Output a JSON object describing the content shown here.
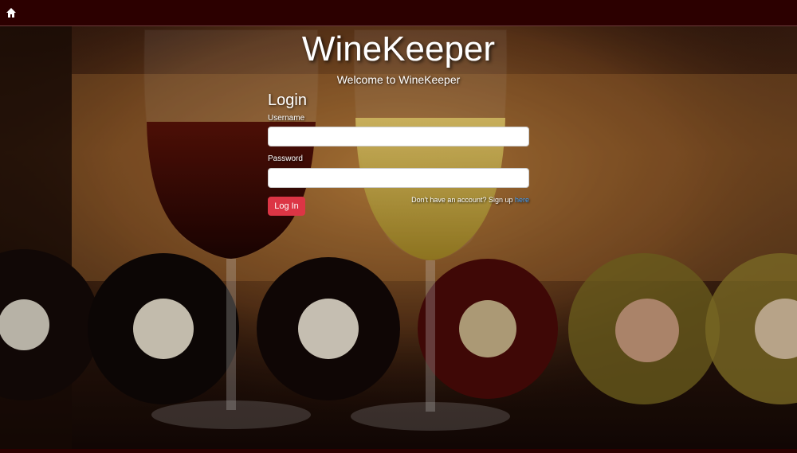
{
  "nav": {
    "home_icon": "home-icon"
  },
  "header": {
    "title": "WineKeeper",
    "subtitle": "Welcome to WineKeeper"
  },
  "login": {
    "heading": "Login",
    "username_label": "Username",
    "username_value": "",
    "password_label": "Password",
    "password_value": "",
    "submit_label": "Log In",
    "signup_text": "Don't have an account? Sign up ",
    "signup_link": "here"
  },
  "colors": {
    "navbar": "#2c0000",
    "button": "#dc3545",
    "link": "#3fa0ff"
  }
}
